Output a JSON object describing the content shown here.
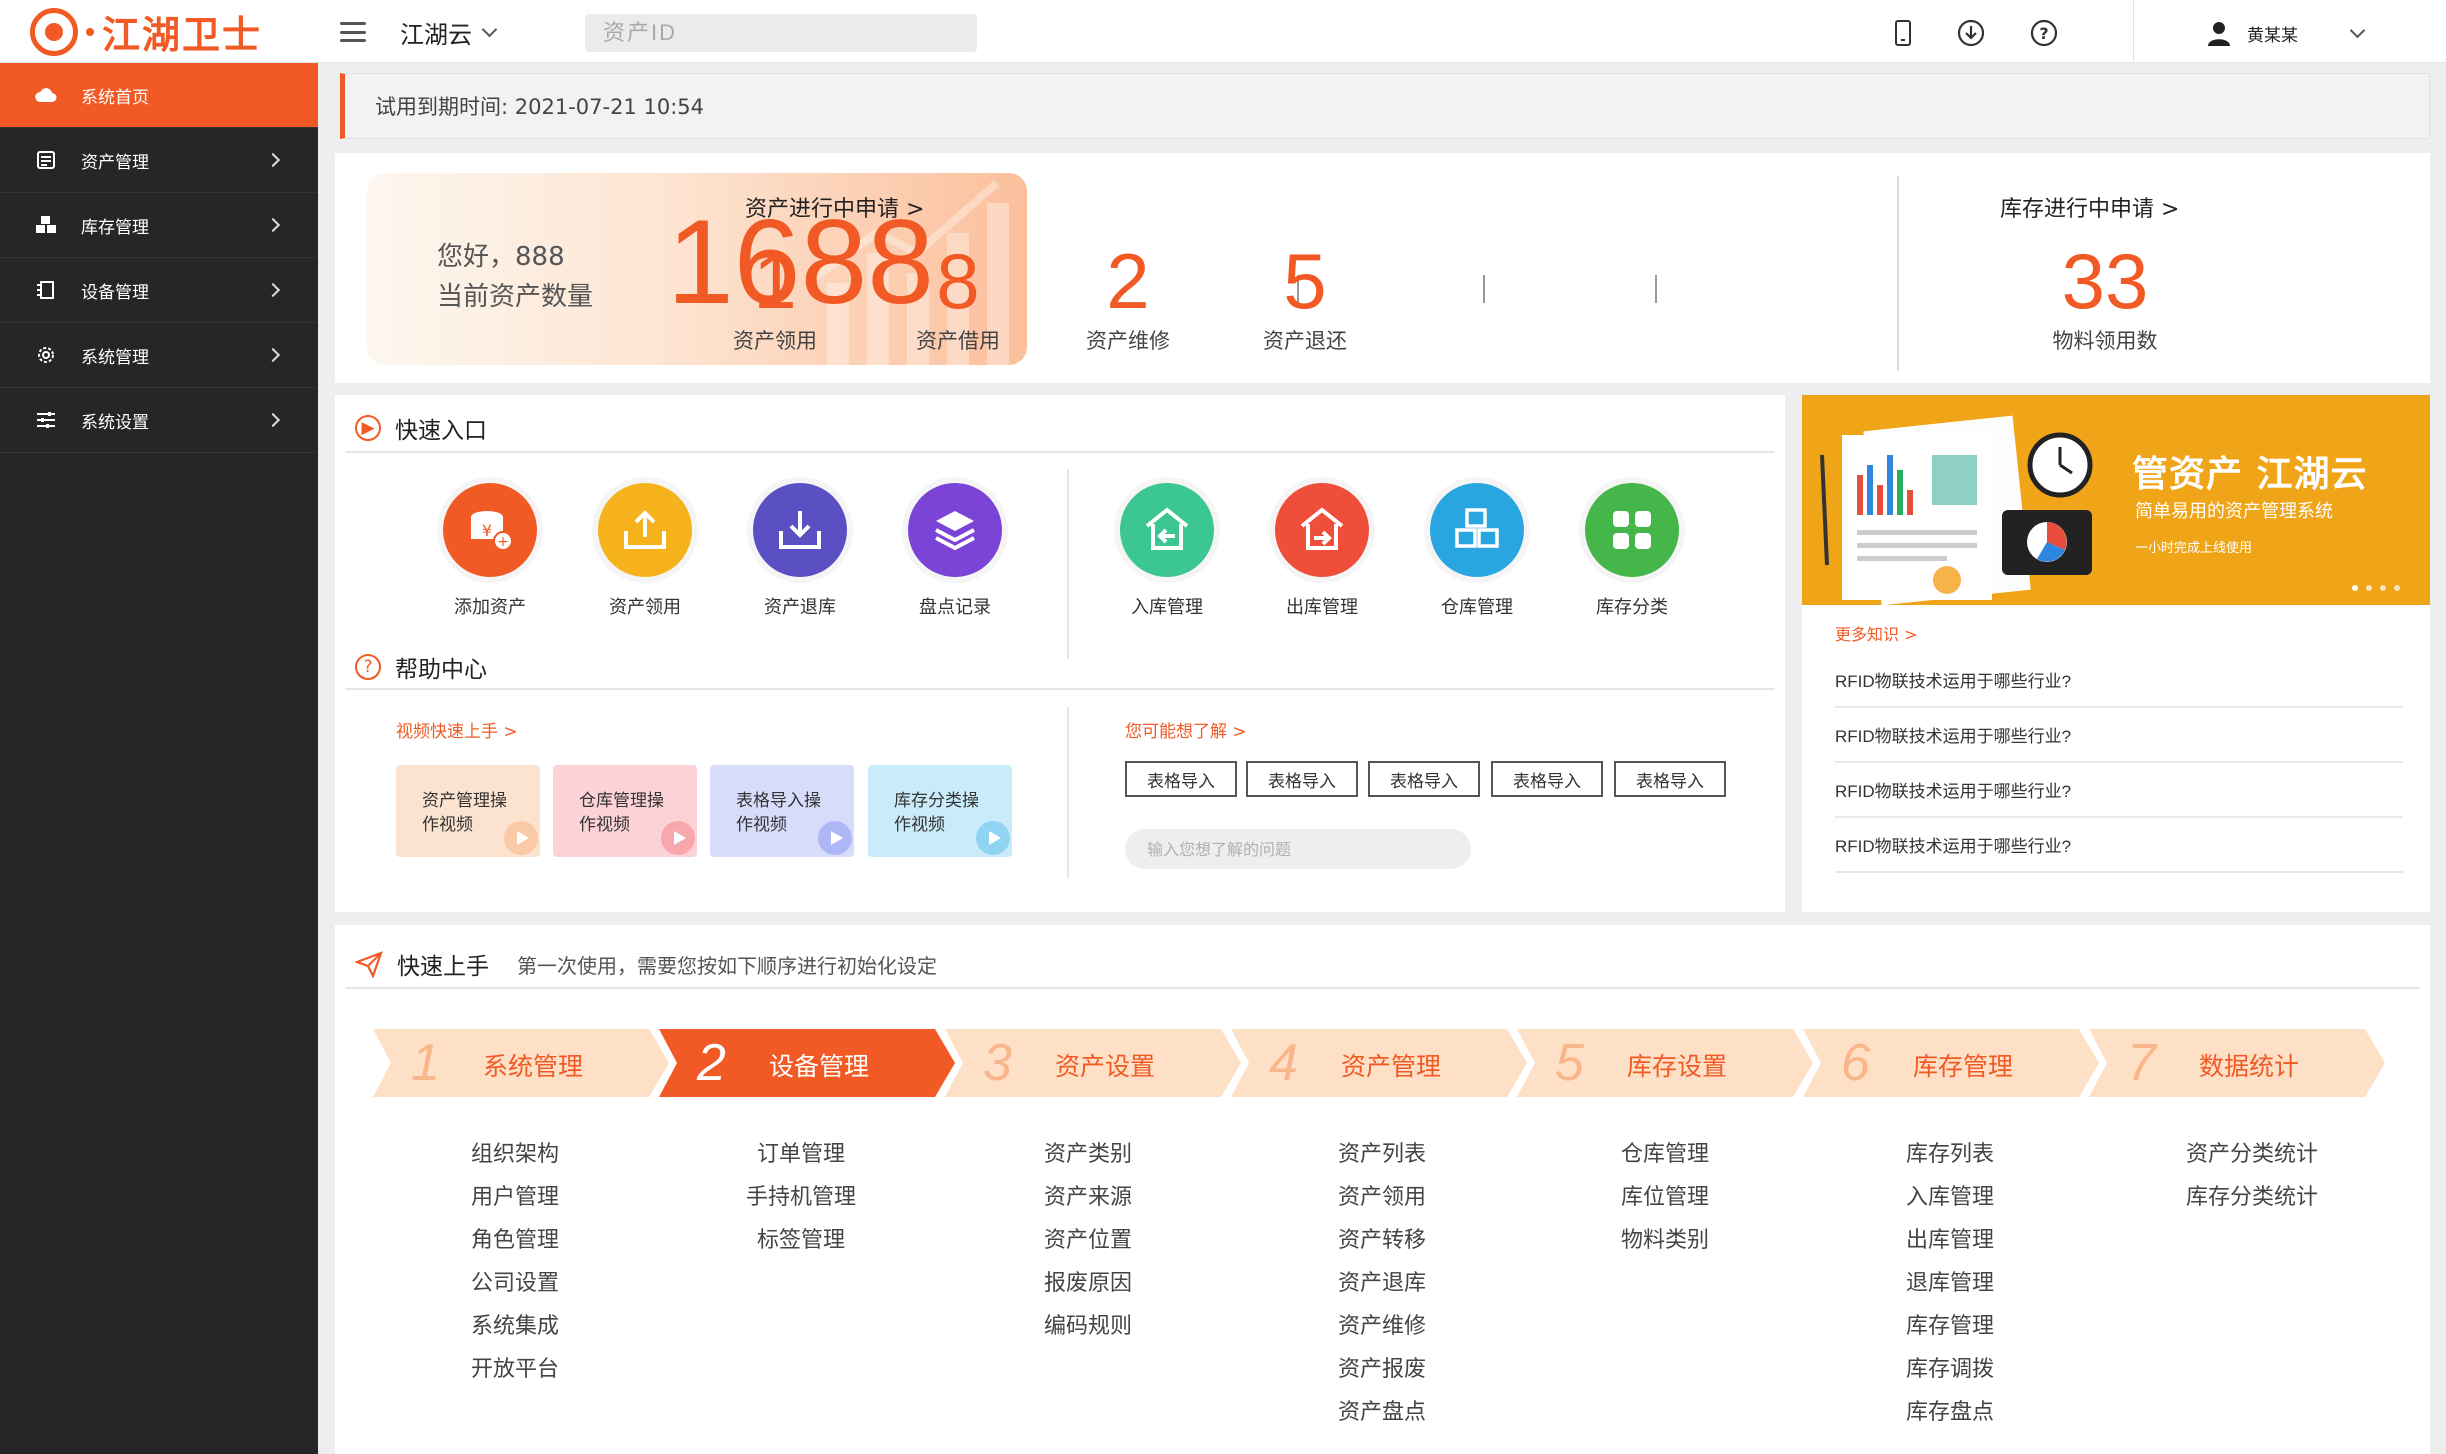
{
  "app": {
    "logo_text": "江湖卫士"
  },
  "topbar": {
    "org": "江湖云",
    "search_placeholder": "资产ID",
    "icons": [
      "mobile-icon",
      "download-icon",
      "help-icon"
    ],
    "user": "黄某某"
  },
  "sidebar": {
    "items": [
      {
        "label": "系统首页",
        "icon": "cloud-icon",
        "active": true
      },
      {
        "label": "资产管理",
        "icon": "asset-icon"
      },
      {
        "label": "库存管理",
        "icon": "inventory-icon"
      },
      {
        "label": "设备管理",
        "icon": "device-icon"
      },
      {
        "label": "系统管理",
        "icon": "gear-icon"
      },
      {
        "label": "系统设置",
        "icon": "sliders-icon"
      }
    ]
  },
  "trial": {
    "text": "试用到期时间: 2021-07-21 10:54"
  },
  "stats": {
    "greeting": "您好，888",
    "count_label": "当前资产数量",
    "total": "1688",
    "asset_title": "资产进行中申请 >",
    "asset_items": [
      {
        "value": "1",
        "label": "资产领用"
      },
      {
        "value": "8",
        "label": "资产借用"
      },
      {
        "value": "2",
        "label": "资产维修"
      },
      {
        "value": "5",
        "label": "资产退还"
      }
    ],
    "stock_title": "库存进行中申请 >",
    "stock_item": {
      "value": "33",
      "label": "物料领用数"
    }
  },
  "quick": {
    "title": "快速入口",
    "items": [
      {
        "label": "添加资产",
        "color": "#f15a24"
      },
      {
        "label": "资产领用",
        "color": "#f5b21c"
      },
      {
        "label": "资产退库",
        "color": "#5b4fc4"
      },
      {
        "label": "盘点记录",
        "color": "#7b44d6"
      },
      {
        "label": "入库管理",
        "color": "#3cc692"
      },
      {
        "label": "出库管理",
        "color": "#ef4f3a"
      },
      {
        "label": "仓库管理",
        "color": "#29a6df"
      },
      {
        "label": "库存分类",
        "color": "#45b649"
      }
    ]
  },
  "help": {
    "title": "帮助中心",
    "video_link": "视频快速上手 >",
    "videos": [
      {
        "line1": "资产管理操",
        "line2": "作视频",
        "bg": "#fbe3cf"
      },
      {
        "line1": "仓库管理操",
        "line2": "作视频",
        "bg": "#fbd3d6"
      },
      {
        "line1": "表格导入操",
        "line2": "作视频",
        "bg": "#d7dcfb"
      },
      {
        "line1": "库存分类操",
        "line2": "作视频",
        "bg": "#c9ebfa"
      }
    ],
    "faq_link": "您可能想了解 >",
    "tags": [
      "表格导入",
      "表格导入",
      "表格导入",
      "表格导入",
      "表格导入"
    ],
    "ask_placeholder": "输入您想了解的问题"
  },
  "knowledge": {
    "banner_title": "管资产 江湖云",
    "banner_sub": "简单易用的资产管理系统",
    "banner_sub2": "一小时完成上线使用",
    "more": "更多知识 >",
    "items": [
      "RFID物联技术运用于哪些行业?",
      "RFID物联技术运用于哪些行业?",
      "RFID物联技术运用于哪些行业?",
      "RFID物联技术运用于哪些行业?"
    ]
  },
  "guide": {
    "title": "快速上手",
    "subtitle": "第一次使用，需要您按如下顺序进行初始化设定",
    "steps": [
      {
        "num": "1",
        "name": "系统管理",
        "active": false,
        "subs": [
          "组织架构",
          "用户管理",
          "角色管理",
          "公司设置",
          "系统集成",
          "开放平台"
        ]
      },
      {
        "num": "2",
        "name": "设备管理",
        "active": true,
        "subs": [
          "订单管理",
          "手持机管理",
          "标签管理"
        ]
      },
      {
        "num": "3",
        "name": "资产设置",
        "active": false,
        "subs": [
          "资产类别",
          "资产来源",
          "资产位置",
          "报废原因",
          "编码规则"
        ]
      },
      {
        "num": "4",
        "name": "资产管理",
        "active": false,
        "subs": [
          "资产列表",
          "资产领用",
          "资产转移",
          "资产退库",
          "资产维修",
          "资产报废",
          "资产盘点"
        ]
      },
      {
        "num": "5",
        "name": "库存设置",
        "active": false,
        "subs": [
          "仓库管理",
          "库位管理",
          "物料类别"
        ]
      },
      {
        "num": "6",
        "name": "库存管理",
        "active": false,
        "subs": [
          "库存列表",
          "入库管理",
          "出库管理",
          "退库管理",
          "库存管理",
          "库存调拨",
          "库存盘点"
        ]
      },
      {
        "num": "7",
        "name": "数据统计",
        "active": false,
        "subs": [
          "资产分类统计",
          "库存分类统计"
        ]
      }
    ]
  },
  "colors": {
    "accent": "#f15a24",
    "sidebar": "#262626",
    "banner": "#f0a417",
    "step_inactive": "#fde0c6",
    "step_text": "#f15a24"
  }
}
